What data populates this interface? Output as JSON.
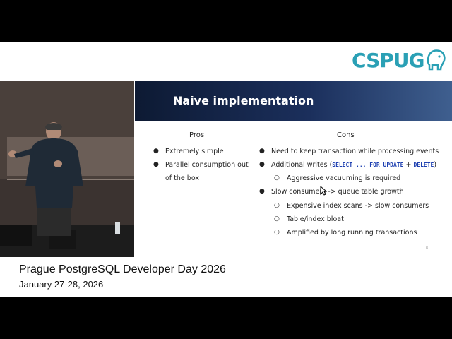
{
  "logo": {
    "text": "CSPUG"
  },
  "slide": {
    "title": "Naive implementation",
    "pros": {
      "heading": "Pros",
      "items": [
        "Extremely simple",
        "Parallel consumption out",
        "of the box"
      ]
    },
    "cons": {
      "heading": "Cons",
      "item1": "Need to keep transaction while processing events",
      "item2": {
        "prefix": "Additional writes (",
        "code1": "SELECT ... FOR UPDATE",
        "plus": " + ",
        "code2": "DELETE",
        "suffix": ")"
      },
      "item2_sub": "Aggressive vacuuming is required",
      "item3": "Slow consumers -> queue table growth",
      "item3_subs": [
        "Expensive index scans -> slow consumers",
        "Table/index bloat",
        "Amplified by long running transactions"
      ]
    },
    "page_number": "8"
  },
  "caption": {
    "title": "Prague PostgreSQL Developer Day 2026",
    "date": "January 27-28, 2026"
  },
  "colors": {
    "header": "#0d1a33",
    "logo": "#2aa0b5",
    "code": "#1d3fb0"
  }
}
